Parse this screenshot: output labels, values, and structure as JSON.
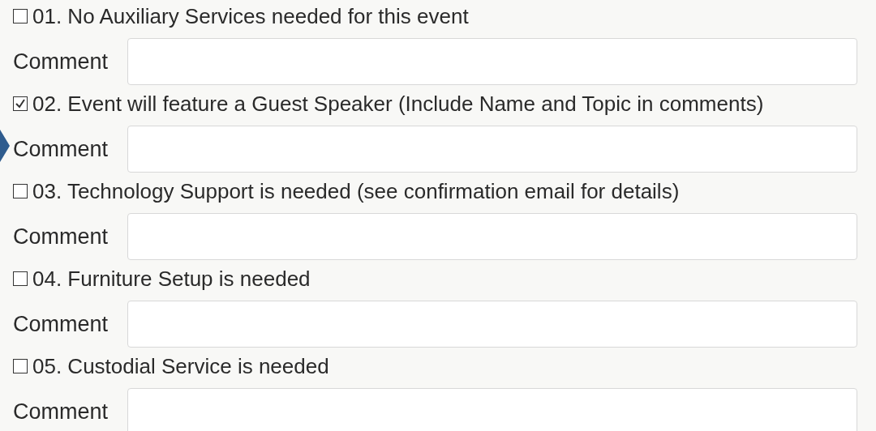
{
  "items": [
    {
      "label": "01. No Auxiliary Services needed for this event",
      "checked": false,
      "comment_label": "Comment"
    },
    {
      "label": "02. Event will feature a Guest Speaker (Include Name and Topic in comments)",
      "checked": true,
      "comment_label": "Comment"
    },
    {
      "label": "03. Technology Support is needed (see confirmation email for details)",
      "checked": false,
      "comment_label": "Comment"
    },
    {
      "label": "04. Furniture Setup is needed",
      "checked": false,
      "comment_label": "Comment"
    },
    {
      "label": "05. Custodial Service is needed",
      "checked": false,
      "comment_label": "Comment"
    }
  ]
}
